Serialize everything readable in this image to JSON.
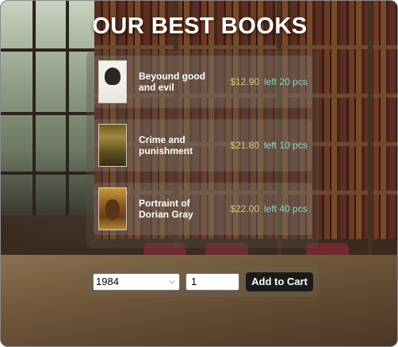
{
  "page": {
    "title": "OUR BEST BOOKS"
  },
  "books": [
    {
      "name": "Beyound good and evil",
      "price": "$12.90",
      "stock": "left 20 pcs",
      "cover_icon": "book-cover-portrait-icon"
    },
    {
      "name": "Crime and punishment",
      "price": "$21.80",
      "stock": "left 10 pcs",
      "cover_icon": "book-cover-icon"
    },
    {
      "name": "Portraint of Dorian Gray",
      "price": "$22.00",
      "stock": "left 40 pcs",
      "cover_icon": "book-cover-portrait-icon"
    }
  ],
  "order": {
    "selected_book": "1984",
    "quantity": "1",
    "add_label": "Add to Cart"
  },
  "colors": {
    "price": "#d6c879",
    "stock": "#7dd9c4",
    "button": "#1a1a1a"
  }
}
